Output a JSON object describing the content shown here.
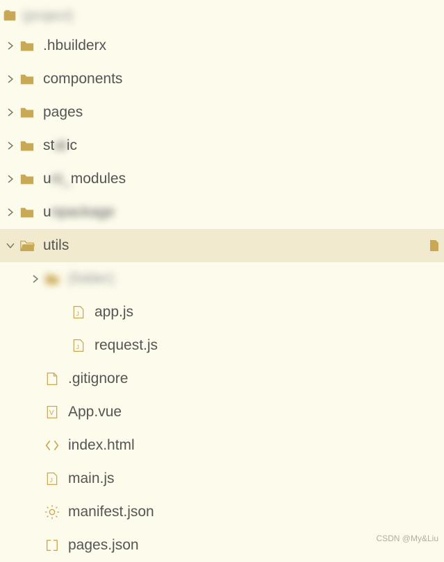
{
  "colors": {
    "folder": "#c9a855",
    "folder_open": "#c9a855",
    "file_outline": "#c9a855",
    "chevron": "#7a7a6a",
    "bg": "#fdfbec",
    "selected": "#f2eace"
  },
  "root": {
    "label": "(project)"
  },
  "tree": [
    {
      "type": "folder",
      "expanded": false,
      "label": ".hbuilderx",
      "indent": 1
    },
    {
      "type": "folder",
      "expanded": false,
      "label": "components",
      "indent": 1
    },
    {
      "type": "folder",
      "expanded": false,
      "label": "pages",
      "indent": 1
    },
    {
      "type": "folder",
      "expanded": false,
      "label": "static",
      "indent": 1,
      "partial_blur": true,
      "prefix": "st",
      "suffix": "ic",
      "mid": "at"
    },
    {
      "type": "folder",
      "expanded": false,
      "label": "uni_modules",
      "indent": 1,
      "partial_blur": true,
      "prefix": "u",
      "suffix": "modules",
      "mid": "ni_"
    },
    {
      "type": "folder",
      "expanded": false,
      "label": "unpackage",
      "indent": 1,
      "partial_blur": true,
      "prefix": "u",
      "suffix": "",
      "mid": "npackage"
    },
    {
      "type": "folder",
      "expanded": true,
      "label": "utils",
      "indent": 1,
      "selected": true
    },
    {
      "type": "folder",
      "expanded": false,
      "label": "(folder)",
      "indent": 2,
      "blurred": true
    },
    {
      "type": "file-js",
      "label": "app.js",
      "indent": 3
    },
    {
      "type": "file-js",
      "label": "request.js",
      "indent": 3
    },
    {
      "type": "file",
      "label": ".gitignore",
      "indent": 2
    },
    {
      "type": "file-vue",
      "label": "App.vue",
      "indent": 2
    },
    {
      "type": "file-html",
      "label": "index.html",
      "indent": 2
    },
    {
      "type": "file-js",
      "label": "main.js",
      "indent": 2
    },
    {
      "type": "file-manifest",
      "label": "manifest.json",
      "indent": 2
    },
    {
      "type": "file-json",
      "label": "pages.json",
      "indent": 2
    }
  ],
  "watermark": "CSDN @My&Liu"
}
